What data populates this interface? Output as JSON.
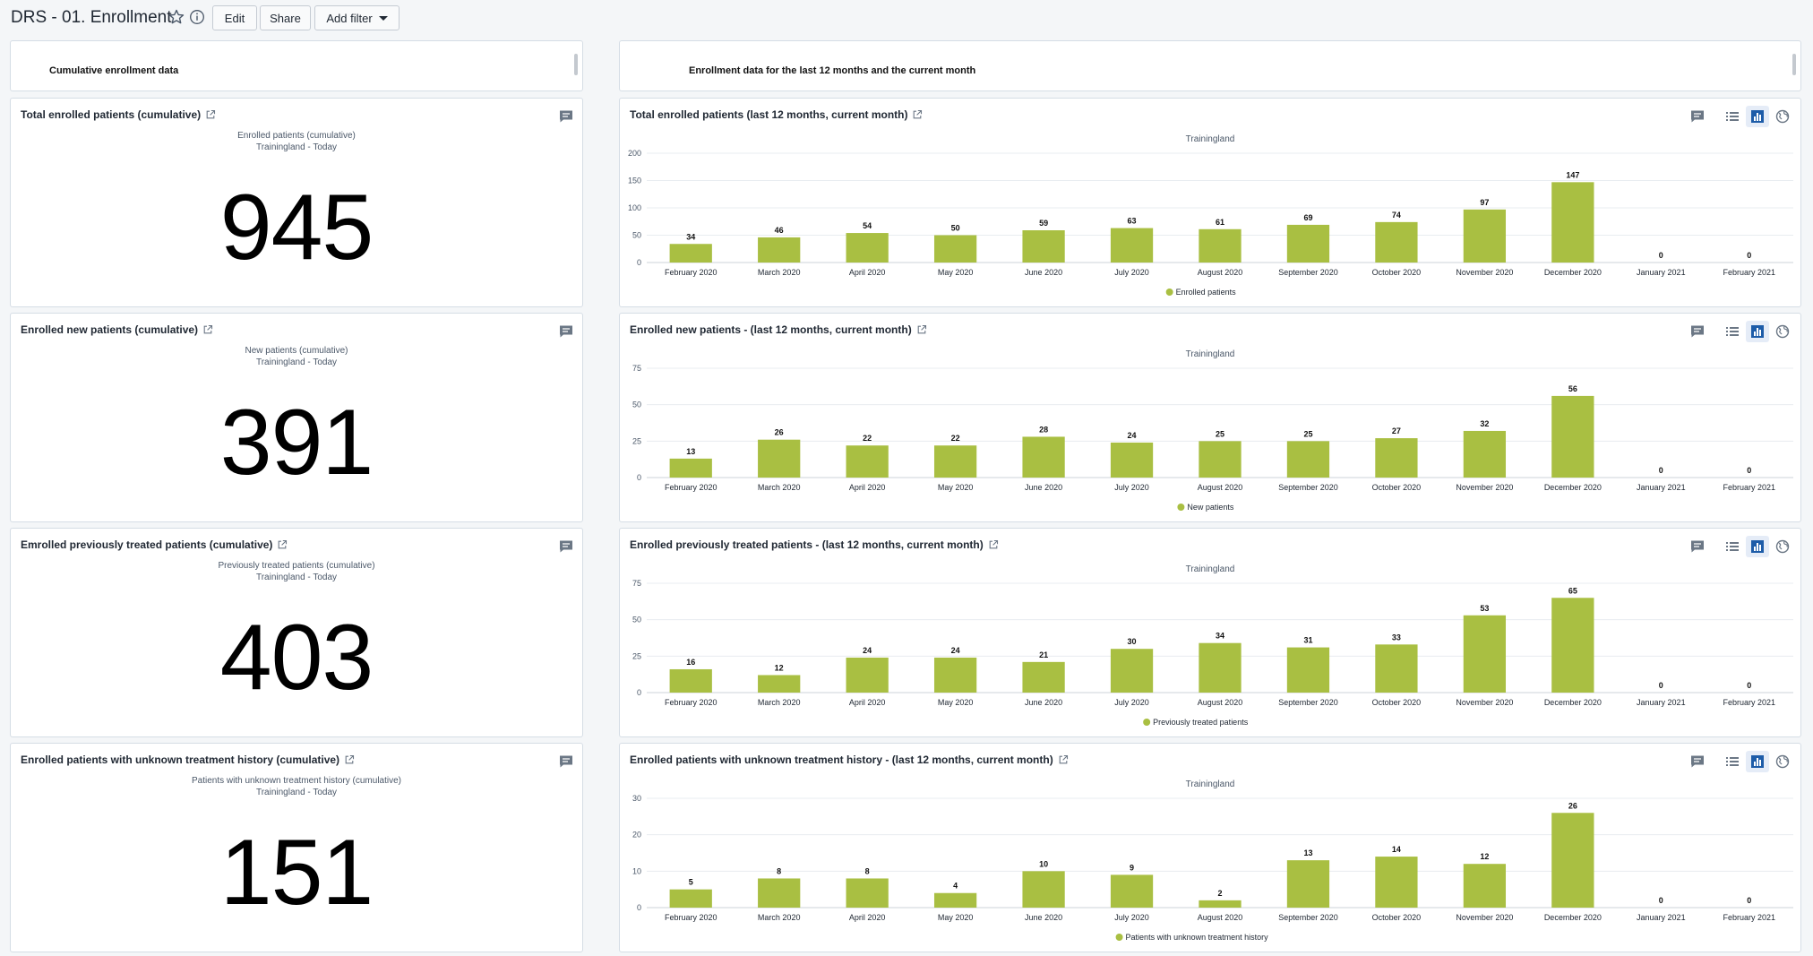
{
  "header": {
    "title": "DRS - 01. Enrollment",
    "edit_label": "Edit",
    "share_label": "Share",
    "add_filter_label": "Add filter"
  },
  "text_items": {
    "left": "Cumulative enrollment data",
    "right": "Enrollment data for the last 12 months and the current month"
  },
  "single_values": [
    {
      "title": "Total enrolled patients (cumulative)",
      "subtitle": "Enrolled patients (cumulative)",
      "period": "Trainingland - Today",
      "value": "945"
    },
    {
      "title": "Enrolled new patients (cumulative)",
      "subtitle": "New patients (cumulative)",
      "period": "Trainingland - Today",
      "value": "391"
    },
    {
      "title": "Emrolled previously treated patients (cumulative)",
      "subtitle": "Previously treated patients (cumulative)",
      "period": "Trainingland - Today",
      "value": "403"
    },
    {
      "title": "Enrolled patients with unknown treatment history (cumulative)",
      "subtitle": "Patients with unknown treatment history (cumulative)",
      "period": "Trainingland - Today",
      "value": "151"
    }
  ],
  "bar_color": "#a9bf42",
  "chart_data": [
    {
      "type": "bar",
      "title": "Total enrolled patients (last 12 months, current month)",
      "subtitle": "Trainingland",
      "categories": [
        "February 2020",
        "March 2020",
        "April 2020",
        "May 2020",
        "June 2020",
        "July 2020",
        "August 2020",
        "September 2020",
        "October 2020",
        "November 2020",
        "December 2020",
        "January 2021",
        "February 2021"
      ],
      "series": [
        {
          "name": "Enrolled patients",
          "values": [
            34,
            46,
            54,
            50,
            59,
            63,
            61,
            69,
            74,
            97,
            147,
            0,
            0
          ]
        }
      ],
      "yticks": [
        0,
        50,
        100,
        150,
        200
      ],
      "ylim": [
        0,
        200
      ],
      "legend": "bottom"
    },
    {
      "type": "bar",
      "title": "Enrolled new patients - (last 12 months, current month)",
      "subtitle": "Trainingland",
      "categories": [
        "February 2020",
        "March 2020",
        "April 2020",
        "May 2020",
        "June 2020",
        "July 2020",
        "August 2020",
        "September 2020",
        "October 2020",
        "November 2020",
        "December 2020",
        "January 2021",
        "February 2021"
      ],
      "series": [
        {
          "name": "New patients",
          "values": [
            13,
            26,
            22,
            22,
            28,
            24,
            25,
            25,
            27,
            32,
            56,
            0,
            0
          ]
        }
      ],
      "yticks": [
        0,
        25,
        50,
        75
      ],
      "ylim": [
        0,
        75
      ],
      "legend": "bottom"
    },
    {
      "type": "bar",
      "title": "Enrolled previously treated patients - (last 12 months, current month)",
      "subtitle": "Trainingland",
      "categories": [
        "February 2020",
        "March 2020",
        "April 2020",
        "May 2020",
        "June 2020",
        "July 2020",
        "August 2020",
        "September 2020",
        "October 2020",
        "November 2020",
        "December 2020",
        "January 2021",
        "February 2021"
      ],
      "series": [
        {
          "name": "Previously treated patients",
          "values": [
            16,
            12,
            24,
            24,
            21,
            30,
            34,
            31,
            33,
            53,
            65,
            0,
            0
          ]
        }
      ],
      "yticks": [
        0,
        25,
        50,
        75
      ],
      "ylim": [
        0,
        75
      ],
      "legend": "bottom"
    },
    {
      "type": "bar",
      "title": "Enrolled patients with unknown treatment history - (last 12 months, current month)",
      "subtitle": "Trainingland",
      "categories": [
        "February 2020",
        "March 2020",
        "April 2020",
        "May 2020",
        "June 2020",
        "July 2020",
        "August 2020",
        "September 2020",
        "October 2020",
        "November 2020",
        "December 2020",
        "January 2021",
        "February 2021"
      ],
      "series": [
        {
          "name": "Patients with unknown treatment history",
          "values": [
            5,
            8,
            8,
            4,
            10,
            9,
            2,
            13,
            14,
            12,
            26,
            0,
            0
          ]
        }
      ],
      "yticks": [
        0,
        10,
        20,
        30
      ],
      "ylim": [
        0,
        30
      ],
      "legend": "bottom"
    }
  ]
}
